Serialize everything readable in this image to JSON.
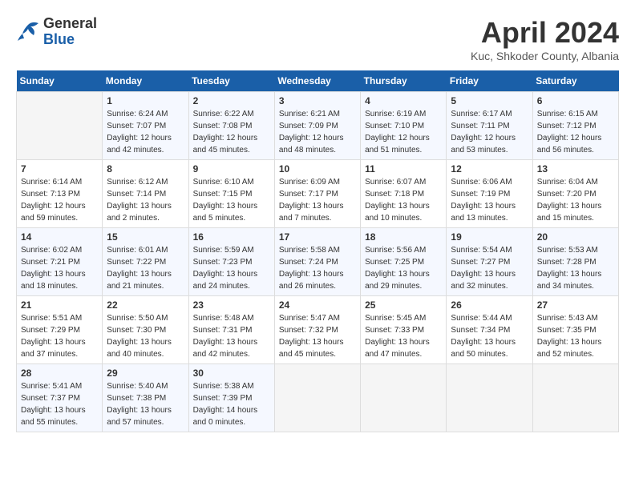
{
  "header": {
    "logo": {
      "general": "General",
      "blue": "Blue"
    },
    "title": "April 2024",
    "location": "Kuc, Shkoder County, Albania"
  },
  "weekdays": [
    "Sunday",
    "Monday",
    "Tuesday",
    "Wednesday",
    "Thursday",
    "Friday",
    "Saturday"
  ],
  "weeks": [
    [
      {
        "day": "",
        "info": ""
      },
      {
        "day": "1",
        "info": "Sunrise: 6:24 AM\nSunset: 7:07 PM\nDaylight: 12 hours\nand 42 minutes."
      },
      {
        "day": "2",
        "info": "Sunrise: 6:22 AM\nSunset: 7:08 PM\nDaylight: 12 hours\nand 45 minutes."
      },
      {
        "day": "3",
        "info": "Sunrise: 6:21 AM\nSunset: 7:09 PM\nDaylight: 12 hours\nand 48 minutes."
      },
      {
        "day": "4",
        "info": "Sunrise: 6:19 AM\nSunset: 7:10 PM\nDaylight: 12 hours\nand 51 minutes."
      },
      {
        "day": "5",
        "info": "Sunrise: 6:17 AM\nSunset: 7:11 PM\nDaylight: 12 hours\nand 53 minutes."
      },
      {
        "day": "6",
        "info": "Sunrise: 6:15 AM\nSunset: 7:12 PM\nDaylight: 12 hours\nand 56 minutes."
      }
    ],
    [
      {
        "day": "7",
        "info": "Sunrise: 6:14 AM\nSunset: 7:13 PM\nDaylight: 12 hours\nand 59 minutes."
      },
      {
        "day": "8",
        "info": "Sunrise: 6:12 AM\nSunset: 7:14 PM\nDaylight: 13 hours\nand 2 minutes."
      },
      {
        "day": "9",
        "info": "Sunrise: 6:10 AM\nSunset: 7:15 PM\nDaylight: 13 hours\nand 5 minutes."
      },
      {
        "day": "10",
        "info": "Sunrise: 6:09 AM\nSunset: 7:17 PM\nDaylight: 13 hours\nand 7 minutes."
      },
      {
        "day": "11",
        "info": "Sunrise: 6:07 AM\nSunset: 7:18 PM\nDaylight: 13 hours\nand 10 minutes."
      },
      {
        "day": "12",
        "info": "Sunrise: 6:06 AM\nSunset: 7:19 PM\nDaylight: 13 hours\nand 13 minutes."
      },
      {
        "day": "13",
        "info": "Sunrise: 6:04 AM\nSunset: 7:20 PM\nDaylight: 13 hours\nand 15 minutes."
      }
    ],
    [
      {
        "day": "14",
        "info": "Sunrise: 6:02 AM\nSunset: 7:21 PM\nDaylight: 13 hours\nand 18 minutes."
      },
      {
        "day": "15",
        "info": "Sunrise: 6:01 AM\nSunset: 7:22 PM\nDaylight: 13 hours\nand 21 minutes."
      },
      {
        "day": "16",
        "info": "Sunrise: 5:59 AM\nSunset: 7:23 PM\nDaylight: 13 hours\nand 24 minutes."
      },
      {
        "day": "17",
        "info": "Sunrise: 5:58 AM\nSunset: 7:24 PM\nDaylight: 13 hours\nand 26 minutes."
      },
      {
        "day": "18",
        "info": "Sunrise: 5:56 AM\nSunset: 7:25 PM\nDaylight: 13 hours\nand 29 minutes."
      },
      {
        "day": "19",
        "info": "Sunrise: 5:54 AM\nSunset: 7:27 PM\nDaylight: 13 hours\nand 32 minutes."
      },
      {
        "day": "20",
        "info": "Sunrise: 5:53 AM\nSunset: 7:28 PM\nDaylight: 13 hours\nand 34 minutes."
      }
    ],
    [
      {
        "day": "21",
        "info": "Sunrise: 5:51 AM\nSunset: 7:29 PM\nDaylight: 13 hours\nand 37 minutes."
      },
      {
        "day": "22",
        "info": "Sunrise: 5:50 AM\nSunset: 7:30 PM\nDaylight: 13 hours\nand 40 minutes."
      },
      {
        "day": "23",
        "info": "Sunrise: 5:48 AM\nSunset: 7:31 PM\nDaylight: 13 hours\nand 42 minutes."
      },
      {
        "day": "24",
        "info": "Sunrise: 5:47 AM\nSunset: 7:32 PM\nDaylight: 13 hours\nand 45 minutes."
      },
      {
        "day": "25",
        "info": "Sunrise: 5:45 AM\nSunset: 7:33 PM\nDaylight: 13 hours\nand 47 minutes."
      },
      {
        "day": "26",
        "info": "Sunrise: 5:44 AM\nSunset: 7:34 PM\nDaylight: 13 hours\nand 50 minutes."
      },
      {
        "day": "27",
        "info": "Sunrise: 5:43 AM\nSunset: 7:35 PM\nDaylight: 13 hours\nand 52 minutes."
      }
    ],
    [
      {
        "day": "28",
        "info": "Sunrise: 5:41 AM\nSunset: 7:37 PM\nDaylight: 13 hours\nand 55 minutes."
      },
      {
        "day": "29",
        "info": "Sunrise: 5:40 AM\nSunset: 7:38 PM\nDaylight: 13 hours\nand 57 minutes."
      },
      {
        "day": "30",
        "info": "Sunrise: 5:38 AM\nSunset: 7:39 PM\nDaylight: 14 hours\nand 0 minutes."
      },
      {
        "day": "",
        "info": ""
      },
      {
        "day": "",
        "info": ""
      },
      {
        "day": "",
        "info": ""
      },
      {
        "day": "",
        "info": ""
      }
    ]
  ]
}
